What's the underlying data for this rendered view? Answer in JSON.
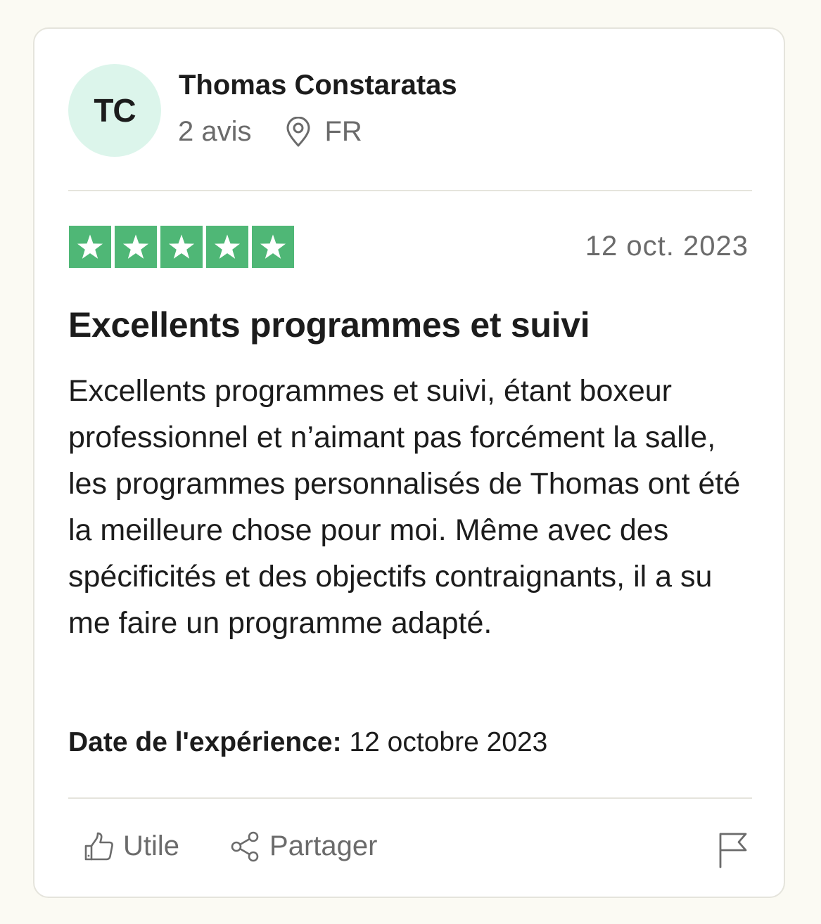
{
  "reviewer": {
    "initials": "TC",
    "name": "Thomas Constaratas",
    "reviews_count": "2 avis",
    "country": "FR"
  },
  "review": {
    "rating": 5,
    "rating_max": 5,
    "date": "12 oct. 2023",
    "title": "Excellents programmes et suivi",
    "body": "Excellents programmes et suivi, étant boxeur professionnel et n’aimant pas forcément la salle, les programmes personnalisés de Thomas ont été la meilleure chose pour moi. Même avec des spécificités et des objectifs contraignants, il a su me faire un programme adapté.",
    "experience_label": "Date de l'expérience:",
    "experience_date": "12 octobre 2023"
  },
  "actions": {
    "useful_label": "Utile",
    "share_label": "Partager"
  },
  "icons": {
    "location": "location-pin-icon",
    "useful": "thumbs-up-icon",
    "share": "share-icon",
    "report": "flag-icon",
    "star": "star-icon"
  },
  "colors": {
    "star_green": "#4fb776",
    "avatar_bg": "#dcf5eb",
    "page_bg": "#fbfaf3",
    "muted_text": "#6b6b6b"
  }
}
